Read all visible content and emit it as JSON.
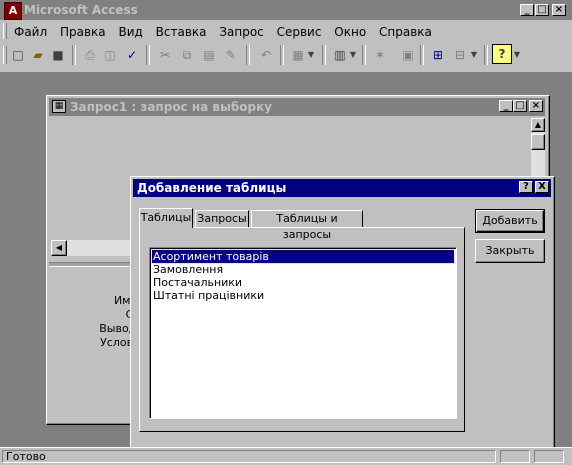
{
  "app": {
    "title": "Microsoft Access"
  },
  "menu": [
    "Файл",
    "Правка",
    "Вид",
    "Вставка",
    "Запрос",
    "Сервис",
    "Окно",
    "Справка"
  ],
  "query_window": {
    "title": "Запрос1 : запрос на выборку",
    "grid_labels": [
      "Имя т",
      "Сор",
      "Вывод н",
      "Условие"
    ]
  },
  "dialog": {
    "title": "Добавление таблицы",
    "help_label": "?",
    "close_label": "X",
    "tabs": [
      "Таблицы",
      "Запросы",
      "Таблицы и запросы"
    ],
    "list_items": [
      "Асортимент товарів",
      "Замовлення",
      "Постачальники",
      "Штатні працівники"
    ],
    "selected_index": 0,
    "add_button": "Добавить",
    "close_button": "Закрыть"
  },
  "status": {
    "text": "Готово"
  },
  "colors": {
    "title_active": "#000080",
    "title_inactive": "#808080",
    "face": "#c0c0c0",
    "workspace": "#808080"
  }
}
